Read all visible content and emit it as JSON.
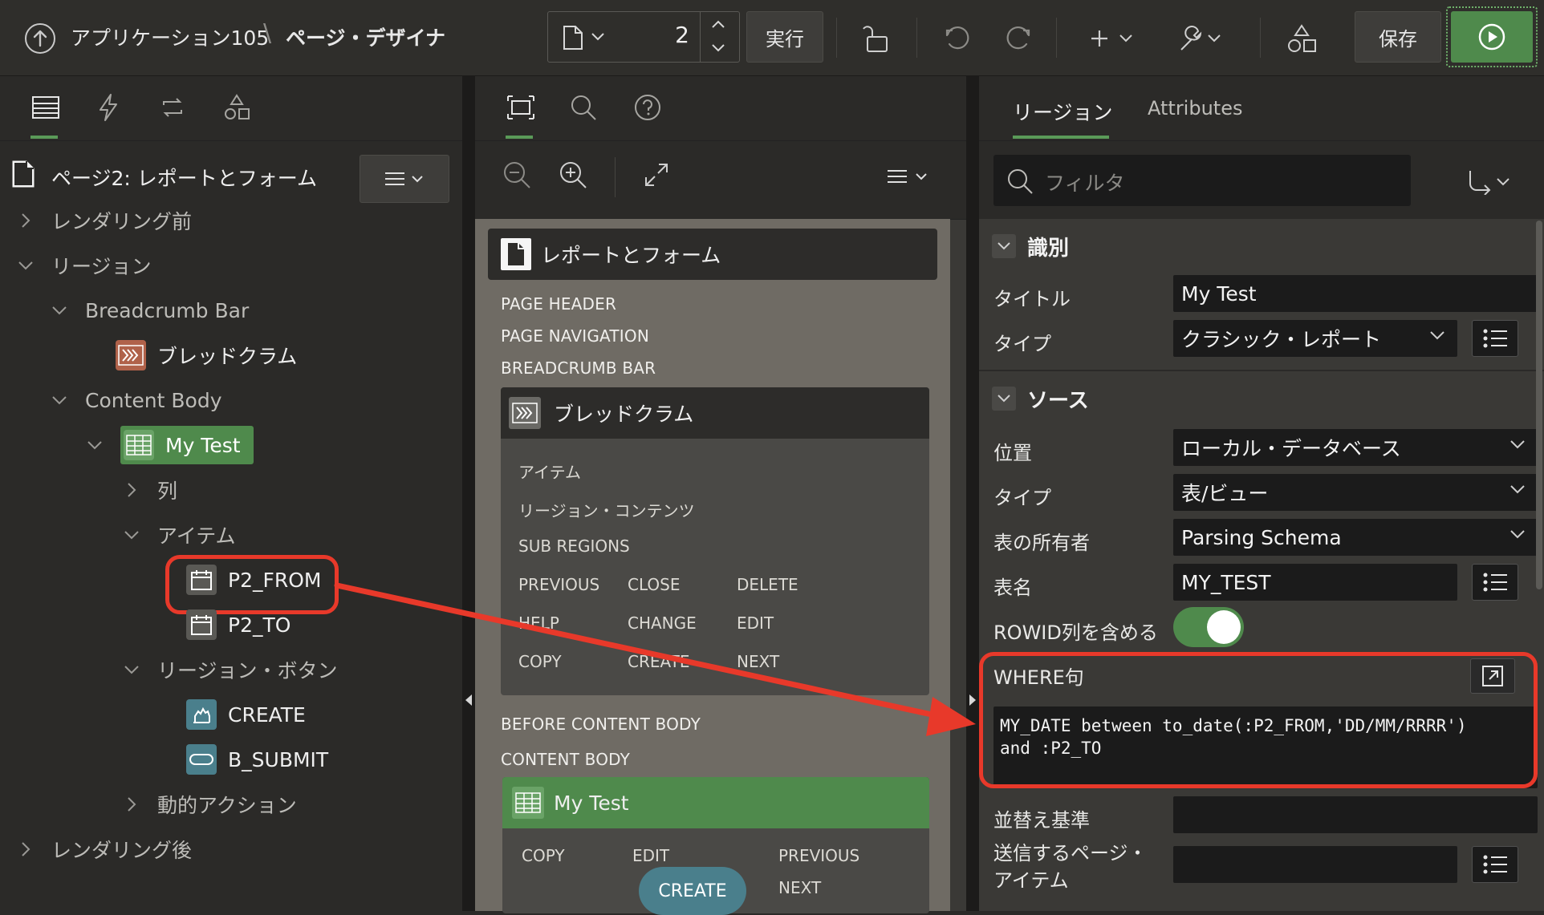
{
  "header": {
    "app_name": "アプリケーション105",
    "separator": "\\",
    "designer": "ページ・デザイナ",
    "page_number": "2",
    "run_label": "実行",
    "save_label": "保存"
  },
  "left": {
    "page_title": "ページ2: レポートとフォーム",
    "tree": {
      "pre_render": "レンダリング前",
      "regions": "リージョン",
      "breadcrumb_bar": "Breadcrumb Bar",
      "breadcrumb": "ブレッドクラム",
      "content_body": "Content Body",
      "my_test": "My Test",
      "columns": "列",
      "items": "アイテム",
      "p2_from": "P2_FROM",
      "p2_to": "P2_TO",
      "region_buttons": "リージョン・ボタン",
      "create": "CREATE",
      "b_submit": "B_SUBMIT",
      "dynamic_actions": "動的アクション",
      "post_render": "レンダリング後"
    }
  },
  "middle": {
    "page_card_title": "レポートとフォーム",
    "page_header": "PAGE HEADER",
    "page_navigation": "PAGE NAVIGATION",
    "breadcrumb_bar": "BREADCRUMB BAR",
    "breadcrumb_title": "ブレッドクラム",
    "bc_items": "アイテム",
    "bc_region_contents": "リージョン・コンテンツ",
    "bc_sub_regions": "SUB REGIONS",
    "bc_positions": [
      "PREVIOUS",
      "CLOSE",
      "DELETE",
      "HELP",
      "CHANGE",
      "EDIT",
      "COPY",
      "CREATE",
      "NEXT"
    ],
    "before_content_body": "BEFORE CONTENT BODY",
    "content_body": "CONTENT BODY",
    "my_test_title": "My Test",
    "mt_positions": [
      "COPY",
      "EDIT",
      "PREVIOUS",
      "NEXT"
    ],
    "create_button": "CREATE"
  },
  "right": {
    "tabs": [
      "リージョン",
      "Attributes"
    ],
    "filter_placeholder": "フィルタ",
    "section_identification": "識別",
    "title_label": "タイトル",
    "title_value": "My Test",
    "type_label": "タイプ",
    "type_value": "クラシック・レポート",
    "section_source": "ソース",
    "location_label": "位置",
    "location_value": "ローカル・データベース",
    "source_type_label": "タイプ",
    "source_type_value": "表/ビュー",
    "owner_label": "表の所有者",
    "owner_value": "Parsing Schema",
    "table_label": "表名",
    "table_value": "MY_TEST",
    "rowid_label": "ROWID列を含める",
    "rowid_on": true,
    "where_label": "WHERE句",
    "where_line1": "MY_DATE between to_date(:P2_FROM,'DD/MM/RRRR')",
    "where_line2": "and :P2_TO",
    "order_label": "並替え基準",
    "submit_label_1": "送信するページ・",
    "submit_label_2": "アイテム"
  },
  "colors": {
    "accent_green": "#4f8a4c",
    "highlight_red": "#e8392a",
    "create_pill": "#4a7f8c"
  }
}
